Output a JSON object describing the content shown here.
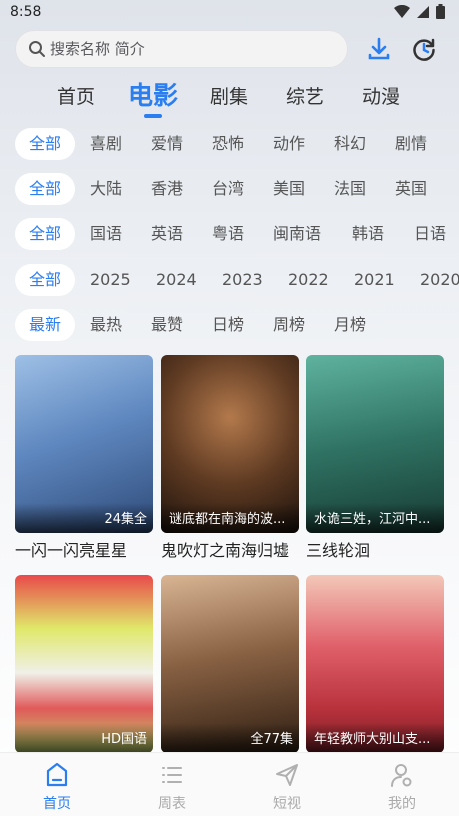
{
  "status": {
    "time": "8:58"
  },
  "search": {
    "placeholder": "搜索名称 简介"
  },
  "category_tabs": [
    "首页",
    "电影",
    "剧集",
    "综艺",
    "动漫"
  ],
  "filters": {
    "genre": [
      "全部",
      "喜剧",
      "爱情",
      "恐怖",
      "动作",
      "科幻",
      "剧情"
    ],
    "region": [
      "全部",
      "大陆",
      "香港",
      "台湾",
      "美国",
      "法国",
      "英国"
    ],
    "language": [
      "全部",
      "国语",
      "英语",
      "粤语",
      "闽南语",
      "韩语",
      "日语"
    ],
    "year": [
      "全部",
      "2025",
      "2024",
      "2023",
      "2022",
      "2021",
      "2020"
    ],
    "sort": [
      "最新",
      "最热",
      "最赞",
      "日榜",
      "周榜",
      "月榜"
    ]
  },
  "movies": [
    {
      "title": "一闪一闪亮星星",
      "badge": "24集全",
      "colors": [
        "#7fa6d6",
        "#3b5f93"
      ]
    },
    {
      "title": "鬼吹灯之南海归墟",
      "badge": "谜底都在南海的波...",
      "colors": [
        "#8a5a3a",
        "#2c1a12"
      ]
    },
    {
      "title": "三线轮洄",
      "badge": "水诡三姓，江河中...",
      "colors": [
        "#3d8f7f",
        "#1f4a44"
      ]
    },
    {
      "title": "",
      "badge": "HD国语",
      "colors": [
        "#d8e86a",
        "#e04a46"
      ]
    },
    {
      "title": "",
      "badge": "全77集",
      "colors": [
        "#c59a78",
        "#3a2618"
      ]
    },
    {
      "title": "",
      "badge": "年轻教师大别山支...",
      "colors": [
        "#d04a52",
        "#8a2a32"
      ]
    }
  ],
  "bottom_nav": [
    "首页",
    "周表",
    "短视",
    "我的"
  ],
  "accent": "#2a7ef0"
}
